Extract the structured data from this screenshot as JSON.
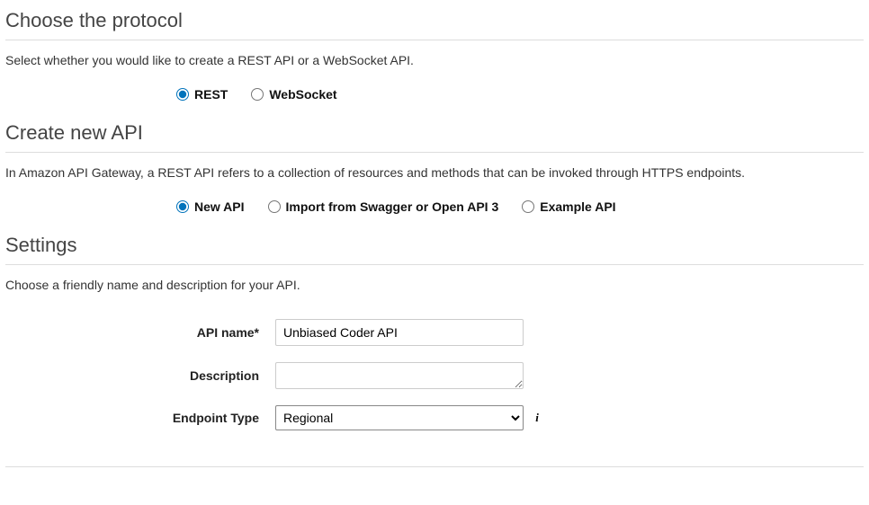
{
  "protocol": {
    "heading": "Choose the protocol",
    "description": "Select whether you would like to create a REST API or a WebSocket API.",
    "options": {
      "rest": "REST",
      "websocket": "WebSocket"
    },
    "selected": "rest"
  },
  "createApi": {
    "heading": "Create new API",
    "description": "In Amazon API Gateway, a REST API refers to a collection of resources and methods that can be invoked through HTTPS endpoints.",
    "options": {
      "newApi": "New API",
      "importSwagger": "Import from Swagger or Open API 3",
      "exampleApi": "Example API"
    },
    "selected": "newApi"
  },
  "settings": {
    "heading": "Settings",
    "description": "Choose a friendly name and description for your API.",
    "fields": {
      "apiName": {
        "label": "API name*",
        "value": "Unbiased Coder API"
      },
      "description": {
        "label": "Description",
        "value": ""
      },
      "endpointType": {
        "label": "Endpoint Type",
        "value": "Regional",
        "options": [
          "Regional"
        ]
      }
    }
  }
}
